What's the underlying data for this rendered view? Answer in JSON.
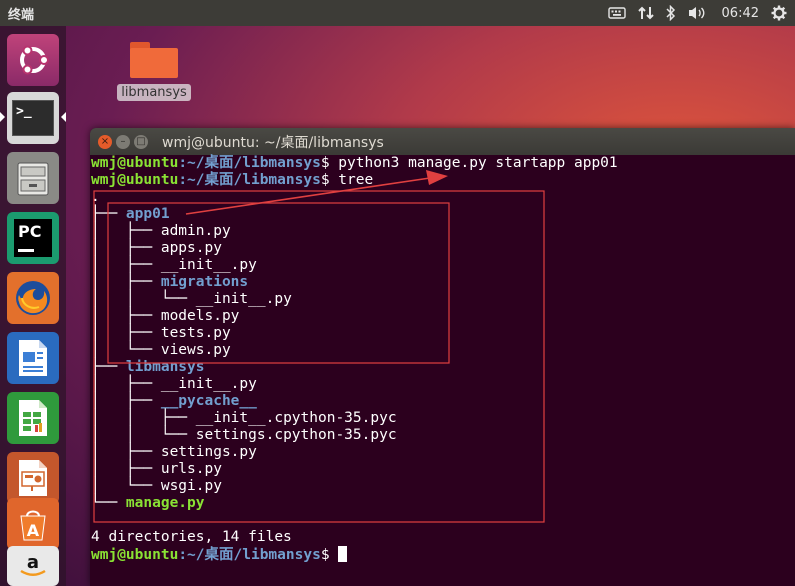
{
  "top_panel": {
    "title": "终端",
    "keyboard": "⌨",
    "network": "⇅",
    "bluetooth": "✱",
    "volume": "🔊",
    "clock": "06:42",
    "power": "⚙"
  },
  "launcher": {
    "items": [
      "ubuntu-dash-icon",
      "terminal-icon",
      "files-icon",
      "pycharm-icon",
      "firefox-icon",
      "writer-icon",
      "calc-icon",
      "impress-icon",
      "software-center-icon",
      "amazon-icon"
    ],
    "pycharm_text": "PC",
    "terminal_text": ">_"
  },
  "desktop": {
    "folder_label": "libmansys"
  },
  "terminal": {
    "title": "wmj@ubuntu: ~/桌面/libmansys",
    "prompt_user": "wmj@ubuntu",
    "prompt_path": ":~/桌面/libmansys",
    "prompt_sign": "$ ",
    "cmd1": "python3 manage.py startapp app01",
    "cmd2": "tree",
    "tree": [
      {
        "prefix": ".",
        "name": "",
        "kind": "plain"
      },
      {
        "prefix": "├── ",
        "name": "app01",
        "kind": "dir"
      },
      {
        "prefix": "│   ├── ",
        "name": "admin.py",
        "kind": "plain"
      },
      {
        "prefix": "│   ├── ",
        "name": "apps.py",
        "kind": "plain"
      },
      {
        "prefix": "│   ├── ",
        "name": "__init__.py",
        "kind": "plain"
      },
      {
        "prefix": "│   ├── ",
        "name": "migrations",
        "kind": "dir"
      },
      {
        "prefix": "│   │   └── ",
        "name": "__init__.py",
        "kind": "plain"
      },
      {
        "prefix": "│   ├── ",
        "name": "models.py",
        "kind": "plain"
      },
      {
        "prefix": "│   ├── ",
        "name": "tests.py",
        "kind": "plain"
      },
      {
        "prefix": "│   └── ",
        "name": "views.py",
        "kind": "plain"
      },
      {
        "prefix": "├── ",
        "name": "libmansys",
        "kind": "dir"
      },
      {
        "prefix": "│   ├── ",
        "name": "__init__.py",
        "kind": "plain"
      },
      {
        "prefix": "│   ├── ",
        "name": "__pycache__",
        "kind": "dir"
      },
      {
        "prefix": "│   │   ├── ",
        "name": "__init__.cpython-35.pyc",
        "kind": "plain"
      },
      {
        "prefix": "│   │   └── ",
        "name": "settings.cpython-35.pyc",
        "kind": "plain"
      },
      {
        "prefix": "│   ├── ",
        "name": "settings.py",
        "kind": "plain"
      },
      {
        "prefix": "│   ├── ",
        "name": "urls.py",
        "kind": "plain"
      },
      {
        "prefix": "│   └── ",
        "name": "wsgi.py",
        "kind": "plain"
      },
      {
        "prefix": "└── ",
        "name": "manage.py",
        "kind": "exec"
      }
    ],
    "summary": "4 directories, 14 files"
  },
  "colors": {
    "terminal_bg": "#2c001e",
    "annotation": "#e04040",
    "prompt_green": "#8ae234",
    "dir_blue": "#729fcf"
  }
}
